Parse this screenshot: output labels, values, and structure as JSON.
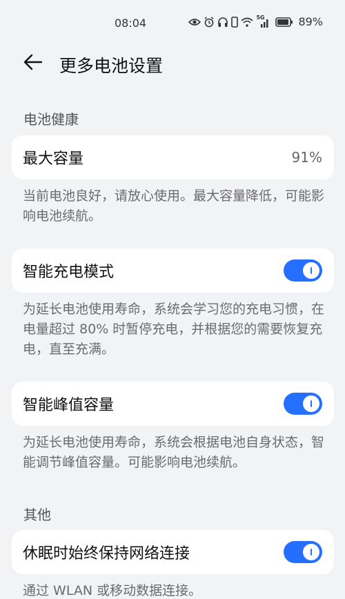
{
  "status_bar": {
    "time": "08:04",
    "network": "5G",
    "battery_pct": "89%"
  },
  "header": {
    "title": "更多电池设置"
  },
  "sections": {
    "battery_health": {
      "label": "电池健康",
      "max_capacity": {
        "title": "最大容量",
        "value": "91%",
        "desc": "当前电池良好，请放心使用。最大容量降低，可能影响电池续航。"
      },
      "smart_charging": {
        "title": "智能充电模式",
        "enabled": true,
        "desc": "为延长电池使用寿命，系统会学习您的充电习惯，在电量超过 80% 时暂停充电，并根据您的需要恢复充电，直至充满。"
      },
      "smart_peak": {
        "title": "智能峰值容量",
        "enabled": true,
        "desc": "为延长电池使用寿命，系统会根据电池自身状态，智能调节峰值容量。可能影响电池续航。"
      }
    },
    "other": {
      "label": "其他",
      "keep_network": {
        "title": "休眠时始终保持网络连接",
        "enabled": true,
        "desc": "通过 WLAN 或移动数据连接。"
      }
    }
  },
  "colors": {
    "toggle_on": "#256fff",
    "background": "#f1f3f5",
    "card": "#ffffff"
  }
}
